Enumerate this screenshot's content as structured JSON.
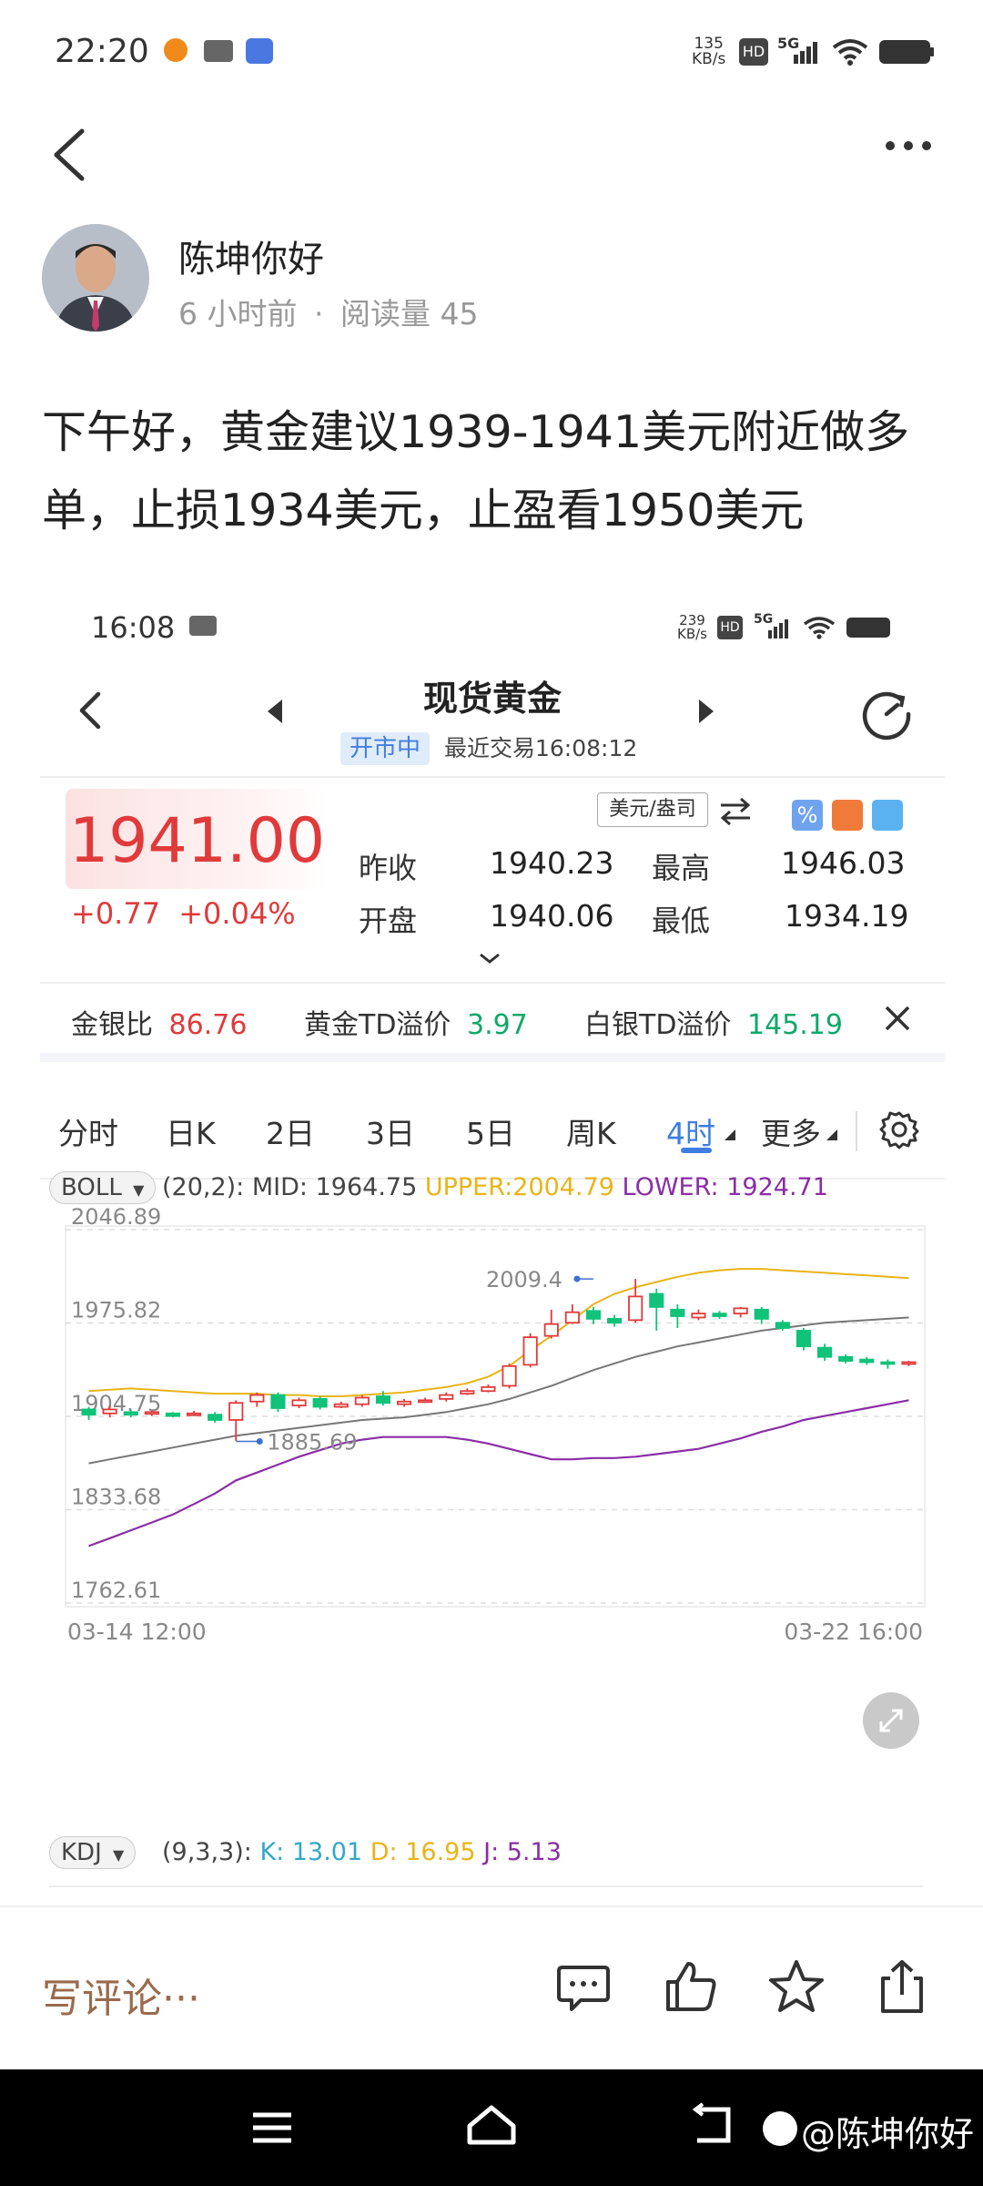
{
  "status_bar": {
    "time": "22:20",
    "net_speed_value": "135",
    "net_speed_unit": "KB/s",
    "hd": "HD",
    "signal": "5G"
  },
  "author": {
    "name": "陈坤你好",
    "time_ago": "6 小时前",
    "separator": "·",
    "read_label": "阅读量",
    "read_count": "45"
  },
  "post": {
    "text": "下午好，黄金建议1939-1941美元附近做多单，止损1934美元，止盈看1950美元"
  },
  "screenshot": {
    "status": {
      "time": "16:08",
      "net_speed_value": "239",
      "net_speed_unit": "KB/s",
      "hd": "HD",
      "signal": "5G"
    },
    "title": "现货黄金",
    "market_status": "开市中",
    "last_trade": "最近交易16:08:12",
    "price": "1941.00",
    "change": "+0.77",
    "change_pct": "+0.04%",
    "unit_toggle": "美元/盎司",
    "stats": {
      "prev_close_label": "昨收",
      "prev_close": "1940.23",
      "high_label": "最高",
      "high": "1946.03",
      "open_label": "开盘",
      "open": "1940.06",
      "low_label": "最低",
      "low": "1934.19"
    },
    "ratios": {
      "gold_silver_label": "金银比",
      "gold_silver": "86.76",
      "gold_td_label": "黄金TD溢价",
      "gold_td": "3.97",
      "silver_td_label": "白银TD溢价",
      "silver_td": "145.19"
    },
    "tabs": [
      "分时",
      "日K",
      "2日",
      "3日",
      "5日",
      "周K",
      "4时",
      "更多"
    ],
    "active_tab": "4时",
    "boll": {
      "name": "BOLL",
      "params": "(20,2):",
      "mid": "MID: 1964.75",
      "upper": "UPPER:2004.79",
      "lower": "LOWER: 1924.71"
    },
    "kdj": {
      "name": "KDJ",
      "params": "(9,3,3):",
      "k": "K: 13.01",
      "d": "D: 16.95",
      "j": "J: 5.13"
    },
    "colors": {
      "up": "#e03a3a",
      "down": "#10c27a",
      "upper": "#e8b417",
      "mid": "#777777",
      "lower": "#8a2da6"
    }
  },
  "chart_data": {
    "type": "candlestick",
    "y_tick_labels": [
      "2046.89",
      "1975.82",
      "1904.75",
      "1833.68",
      "1762.61"
    ],
    "ylim": [
      1762.61,
      2046.89
    ],
    "x_labels": [
      "03-14 12:00",
      "03-22 16:00"
    ],
    "annotations": [
      {
        "label": "2009.4",
        "value": 2009.4,
        "index": 24
      },
      {
        "label": "1885.69",
        "value": 1885.69,
        "index": 7
      }
    ],
    "candles": [
      [
        1910,
        1906,
        1912,
        1902
      ],
      [
        1907,
        1910,
        1913,
        1904
      ],
      [
        1908,
        1906,
        1910,
        1904
      ],
      [
        1907,
        1908,
        1909,
        1905
      ],
      [
        1907,
        1905,
        1908,
        1904
      ],
      [
        1906,
        1907,
        1909,
        1905
      ],
      [
        1906,
        1902,
        1908,
        1900
      ],
      [
        1902,
        1915,
        1917,
        1886
      ],
      [
        1916,
        1921,
        1923,
        1912
      ],
      [
        1921,
        1911,
        1923,
        1908
      ],
      [
        1913,
        1917,
        1919,
        1911
      ],
      [
        1918,
        1912,
        1920,
        1910
      ],
      [
        1912,
        1914,
        1916,
        1911
      ],
      [
        1914,
        1919,
        1921,
        1912
      ],
      [
        1920,
        1915,
        1924,
        1913
      ],
      [
        1914,
        1916,
        1918,
        1912
      ],
      [
        1916,
        1917,
        1919,
        1915
      ],
      [
        1918,
        1921,
        1923,
        1916
      ],
      [
        1922,
        1924,
        1926,
        1921
      ],
      [
        1924,
        1927,
        1929,
        1923
      ],
      [
        1928,
        1943,
        1945,
        1926
      ],
      [
        1944,
        1965,
        1968,
        1942
      ],
      [
        1966,
        1975,
        1986,
        1964
      ],
      [
        1976,
        1984,
        1990,
        1975
      ],
      [
        1985,
        1979,
        1988,
        1975
      ],
      [
        1979,
        1976,
        1982,
        1973
      ],
      [
        1978,
        1996,
        2009.4,
        1976
      ],
      [
        1998,
        1988,
        2002,
        1970
      ],
      [
        1986,
        1981,
        1990,
        1972
      ],
      [
        1980,
        1983,
        1986,
        1978
      ],
      [
        1983,
        1981,
        1985,
        1979
      ],
      [
        1983,
        1987,
        1988,
        1980
      ],
      [
        1986,
        1979,
        1988,
        1975
      ],
      [
        1976,
        1972,
        1978,
        1970
      ],
      [
        1970,
        1958,
        1972,
        1955
      ],
      [
        1957,
        1950,
        1960,
        1947
      ],
      [
        1950,
        1947,
        1952,
        1945
      ],
      [
        1948,
        1946,
        1950,
        1944
      ],
      [
        1946,
        1945,
        1948,
        1941
      ],
      [
        1945,
        1946,
        1947,
        1943
      ]
    ],
    "upper": [
      1924,
      1925,
      1926,
      1925,
      1924,
      1923,
      1922,
      1922,
      1922,
      1921,
      1921,
      1920,
      1920,
      1921,
      1922,
      1923,
      1925,
      1927,
      1930,
      1935,
      1943,
      1955,
      1966,
      1978,
      1990,
      1998,
      2003,
      2007,
      2011,
      2014,
      2016,
      2017,
      2017,
      2016,
      2015,
      2014,
      2013,
      2012,
      2011,
      2010
    ],
    "mid": [
      1869,
      1872,
      1875,
      1878,
      1881,
      1884,
      1887,
      1890,
      1892,
      1894,
      1896,
      1898,
      1900,
      1902,
      1903,
      1904,
      1906,
      1908,
      1911,
      1914,
      1918,
      1923,
      1928,
      1934,
      1940,
      1945,
      1950,
      1954,
      1958,
      1961,
      1964,
      1967,
      1970,
      1972,
      1974,
      1976,
      1977,
      1978,
      1979,
      1980
    ],
    "lower": [
      1806,
      1812,
      1818,
      1824,
      1830,
      1838,
      1846,
      1856,
      1862,
      1868,
      1874,
      1879,
      1884,
      1887,
      1889,
      1889,
      1889,
      1889,
      1887,
      1884,
      1880,
      1876,
      1872,
      1872,
      1873,
      1873,
      1874,
      1876,
      1878,
      1880,
      1884,
      1888,
      1893,
      1897,
      1902,
      1905,
      1908,
      1911,
      1914,
      1917
    ]
  },
  "bottom": {
    "comment_placeholder": "写评论···"
  },
  "watermark": "@陈坤你好"
}
